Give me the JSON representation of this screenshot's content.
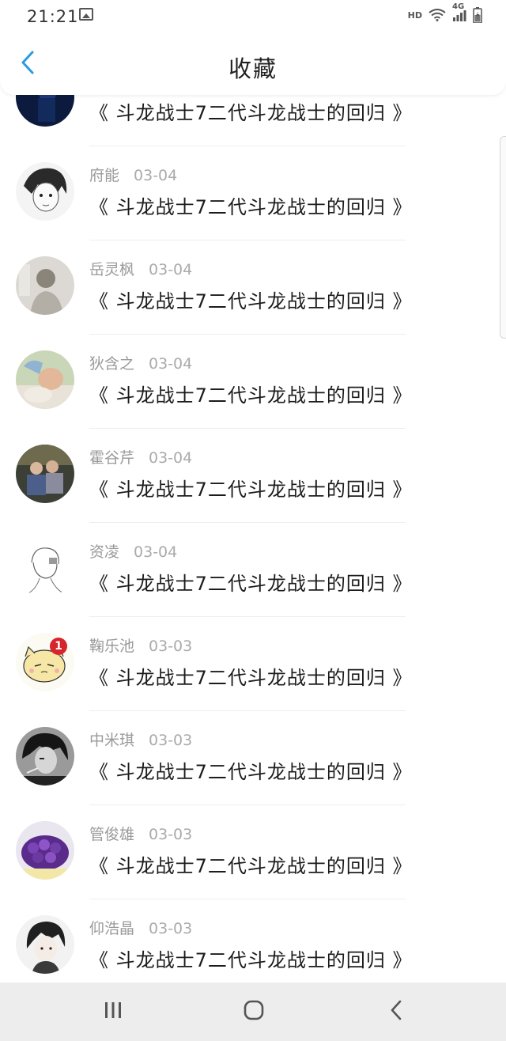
{
  "status_bar": {
    "time": "21:21",
    "network_label": "HD",
    "cell_label": "4G"
  },
  "header": {
    "title": "收藏"
  },
  "colors": {
    "accent": "#2b9be0",
    "badge": "#d8242c",
    "meta_text": "#9a9a9a"
  },
  "list": {
    "items": [
      {
        "author": "",
        "date": "",
        "title": "《 斗龙战士7二代斗龙战士的回归 》",
        "avatar": "blue-night-avatar"
      },
      {
        "author": "府能",
        "date": "03-04",
        "title": "《 斗龙战士7二代斗龙战士的回归 》",
        "avatar": "manga-girl-avatar"
      },
      {
        "author": "岳灵枫",
        "date": "03-04",
        "title": "《 斗龙战士7二代斗龙战士的回归 》",
        "avatar": "sketch-boy-avatar"
      },
      {
        "author": "狄含之",
        "date": "03-04",
        "title": "《 斗龙战士7二代斗龙战士的回归 》",
        "avatar": "sleeping-baby-avatar"
      },
      {
        "author": "霍谷芹",
        "date": "03-04",
        "title": "《 斗龙战士7二代斗龙战士的回归 》",
        "avatar": "group-photo-avatar"
      },
      {
        "author": "资凌",
        "date": "03-04",
        "title": "《 斗龙战士7二代斗龙战士的回归 》",
        "avatar": "line-drawing-avatar"
      },
      {
        "author": "鞠乐池",
        "date": "03-03",
        "title": "《 斗龙战士7二代斗龙战士的回归 》",
        "avatar": "cartoon-cat-avatar",
        "badge": "1"
      },
      {
        "author": "中米琪",
        "date": "03-03",
        "title": "《 斗龙战士7二代斗龙战士的回归 》",
        "avatar": "bw-portrait-avatar"
      },
      {
        "author": "管俊雄",
        "date": "03-03",
        "title": "《 斗龙战士7二代斗龙战士的回归 》",
        "avatar": "purple-flowers-avatar"
      },
      {
        "author": "仰浩晶",
        "date": "03-03",
        "title": "《 斗龙战士7二代斗龙战士的回归 》",
        "avatar": "anime-boy-avatar"
      }
    ]
  }
}
